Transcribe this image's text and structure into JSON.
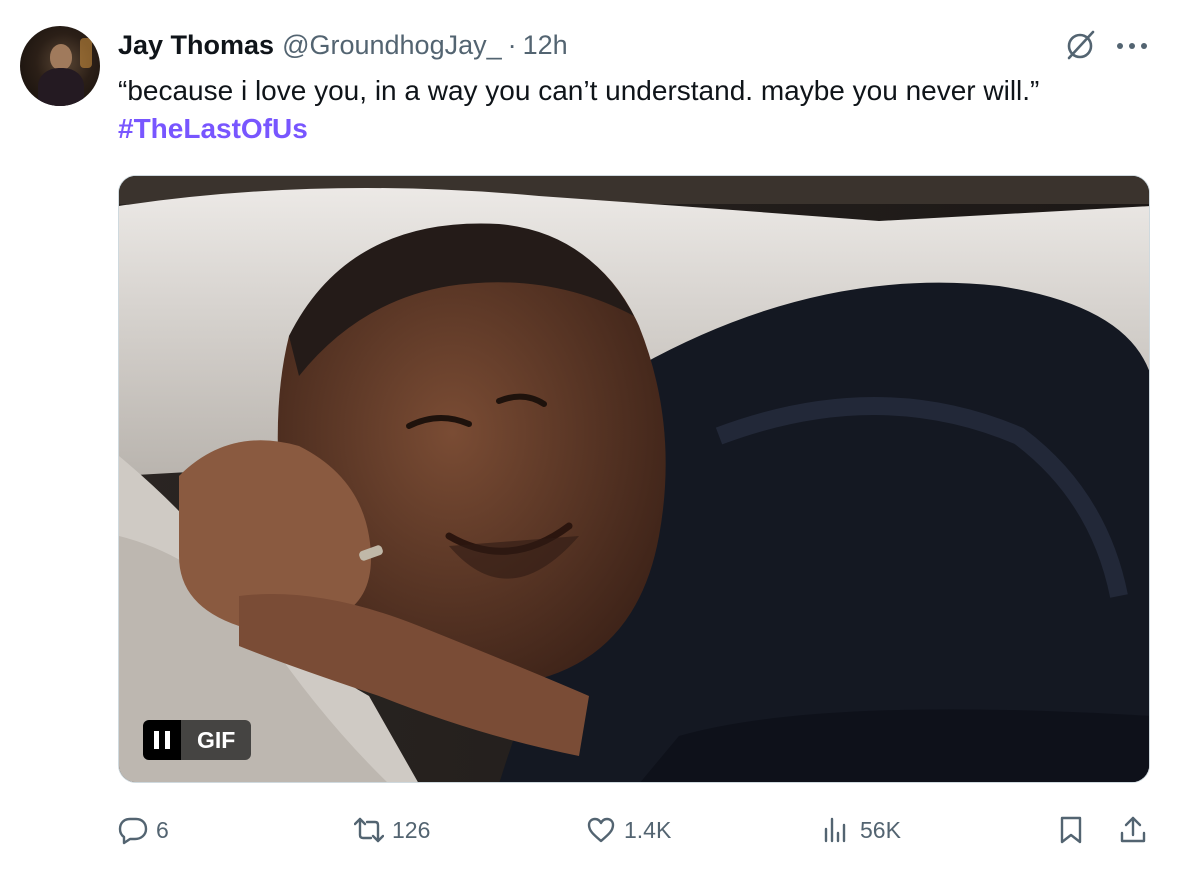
{
  "tweet": {
    "display_name": "Jay Thomas",
    "handle": "@GroundhogJay_",
    "separator": "·",
    "time": "12h",
    "text": "“because i love you, in a way you can’t understand. maybe you never will.”",
    "hashtag": "#TheLastOfUs",
    "media": {
      "badge_label": "GIF",
      "pause_icon": "pause-icon"
    }
  },
  "actions": {
    "replies": "6",
    "reposts": "126",
    "likes": "1.4K",
    "views": "56K"
  },
  "icons": {
    "grok": "grok-icon",
    "more": "more-icon",
    "reply": "reply-icon",
    "repost": "repost-icon",
    "like": "heart-icon",
    "views": "views-icon",
    "bookmark": "bookmark-icon",
    "share": "share-icon"
  },
  "colors": {
    "text": "#0f1419",
    "secondary": "#536471",
    "hashtag": "#7856ff"
  }
}
